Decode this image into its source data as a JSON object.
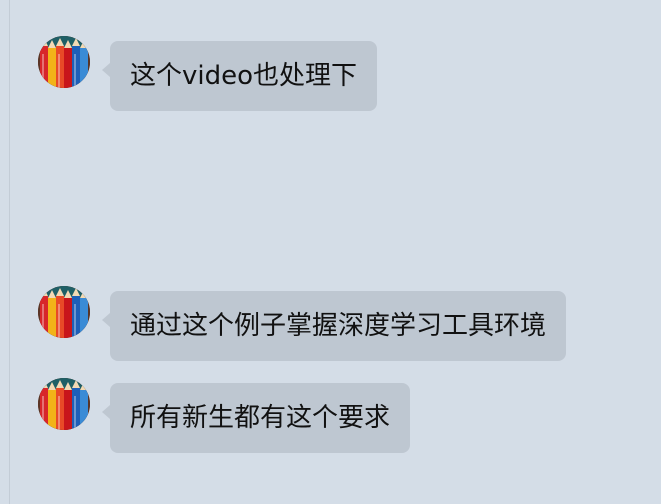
{
  "chat": {
    "messages": [
      {
        "sender_avatar": "colored-pencils-avatar",
        "text": "这个video也处理下"
      },
      {
        "sender_avatar": "colored-pencils-avatar",
        "text": "通过这个例子掌握深度学习工具环境"
      },
      {
        "sender_avatar": "colored-pencils-avatar",
        "text": "所有新生都有这个要求"
      }
    ]
  },
  "colors": {
    "background": "#d4dde7",
    "bubble": "#bec7d1",
    "text": "#111111"
  }
}
